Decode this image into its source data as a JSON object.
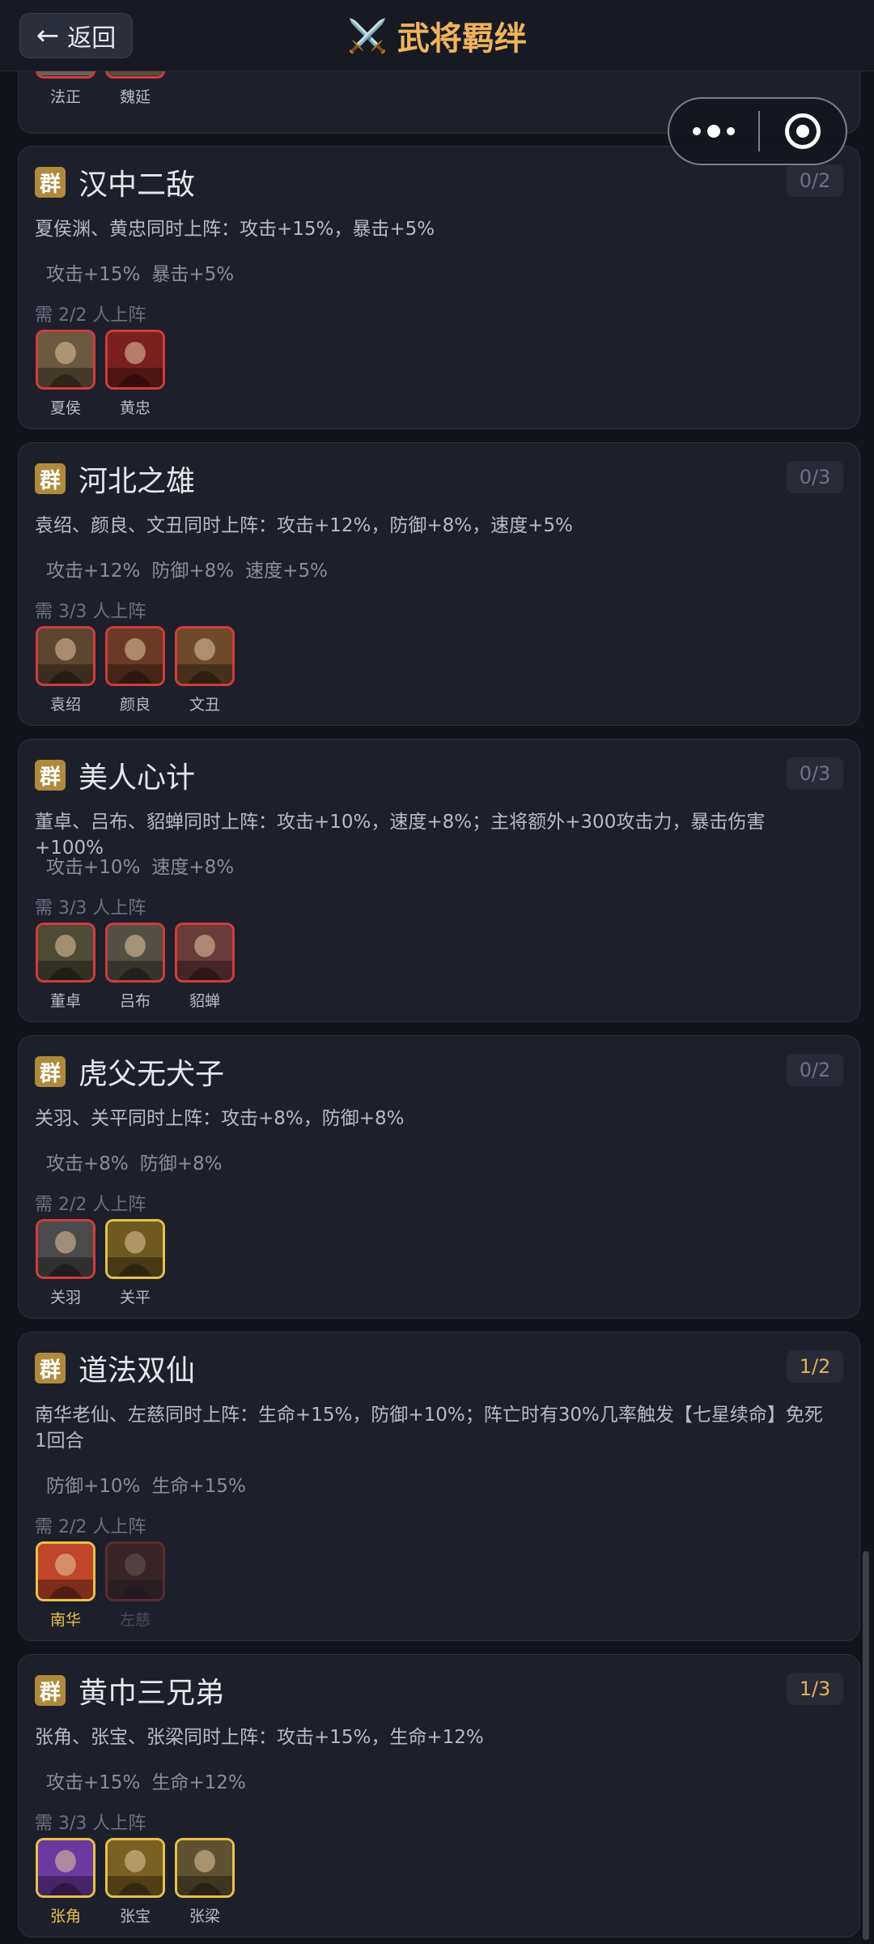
{
  "header": {
    "back_label": "返回",
    "title": "武将羁绊",
    "title_icon": "crossed-swords-icon",
    "title_emoji": "⚔️"
  },
  "capsule": {
    "more_icon": "more-dots-icon",
    "close_icon": "target-close-icon"
  },
  "partial_card": {
    "heroes": [
      {
        "name": "法正",
        "state": "inactive"
      },
      {
        "name": "魏延",
        "state": "inactive"
      }
    ]
  },
  "faction_label": "群",
  "bonds": [
    {
      "title": "汉中二敌",
      "count": "0/2",
      "active": false,
      "desc": "夏侯渊、黄忠同时上阵：攻击+15%，暴击+5%",
      "tags": [
        "攻击+15%",
        "暴击+5%"
      ],
      "need": "需 2/2 人上阵",
      "heroes": [
        {
          "name": "夏侯",
          "state": "inactive",
          "color": "#6b5a40"
        },
        {
          "name": "黄忠",
          "state": "inactive",
          "color": "#7a2020"
        }
      ]
    },
    {
      "title": "河北之雄",
      "count": "0/3",
      "active": false,
      "desc": "袁绍、颜良、文丑同时上阵：攻击+12%，防御+8%，速度+5%",
      "tags": [
        "攻击+12%",
        "防御+8%",
        "速度+5%"
      ],
      "need": "需 3/3 人上阵",
      "heroes": [
        {
          "name": "袁绍",
          "state": "inactive",
          "color": "#5c4630"
        },
        {
          "name": "颜良",
          "state": "inactive",
          "color": "#6a3a26"
        },
        {
          "name": "文丑",
          "state": "inactive",
          "color": "#6e4a2a"
        }
      ]
    },
    {
      "title": "美人心计",
      "count": "0/3",
      "active": false,
      "desc": "董卓、吕布、貂蝉同时上阵：攻击+10%，速度+8%；主将额外+300攻击力，暴击伤害+100%",
      "tags": [
        "攻击+10%",
        "速度+8%"
      ],
      "need": "需 3/3 人上阵",
      "heroes": [
        {
          "name": "董卓",
          "state": "inactive",
          "color": "#4e4a36"
        },
        {
          "name": "吕布",
          "state": "inactive",
          "color": "#545045"
        },
        {
          "name": "貂蝉",
          "state": "inactive",
          "color": "#6b3a3a"
        }
      ]
    },
    {
      "title": "虎父无犬子",
      "count": "0/2",
      "active": false,
      "desc": "关羽、关平同时上阵：攻击+8%，防御+8%",
      "tags": [
        "攻击+8%",
        "防御+8%"
      ],
      "need": "需 2/2 人上阵",
      "heroes": [
        {
          "name": "关羽",
          "state": "inactive",
          "color": "#4b4b4b"
        },
        {
          "name": "关平",
          "state": "owned",
          "color": "#6e5a20"
        }
      ]
    },
    {
      "title": "道法双仙",
      "count": "1/2",
      "active": true,
      "desc": "南华老仙、左慈同时上阵：生命+15%，防御+10%；阵亡时有30%几率触发【七星续命】免死1回合",
      "tags": [
        "防御+10%",
        "生命+15%"
      ],
      "need": "需 2/2 人上阵",
      "heroes": [
        {
          "name": "南华",
          "state": "active",
          "color": "#c0452a"
        },
        {
          "name": "左慈",
          "state": "dim",
          "color": "#6a2a22"
        }
      ]
    },
    {
      "title": "黄巾三兄弟",
      "count": "1/3",
      "active": true,
      "desc": "张角、张宝、张梁同时上阵：攻击+15%，生命+12%",
      "tags": [
        "攻击+15%",
        "生命+12%"
      ],
      "need": "需 3/3 人上阵",
      "heroes": [
        {
          "name": "张角",
          "state": "active",
          "color": "#6a3aa0"
        },
        {
          "name": "张宝",
          "state": "owned",
          "color": "#7a6022"
        },
        {
          "name": "张梁",
          "state": "owned",
          "color": "#5e5230"
        }
      ]
    }
  ]
}
